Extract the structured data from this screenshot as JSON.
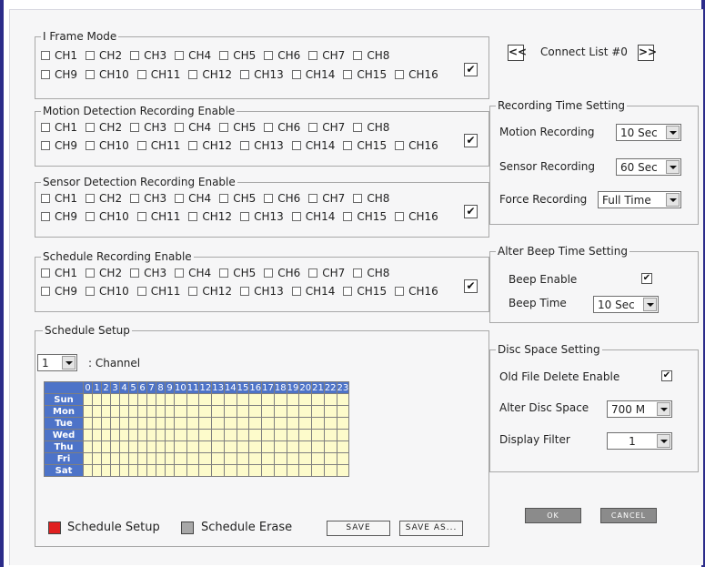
{
  "sections": {
    "iframe": {
      "legend": "I Frame Mode",
      "row1": [
        "CH1",
        "CH2",
        "CH3",
        "CH4",
        "CH5",
        "CH6",
        "CH7",
        "CH8"
      ],
      "row2": [
        "CH9",
        "CH10",
        "CH11",
        "CH12",
        "CH13",
        "CH14",
        "CH15",
        "CH16"
      ],
      "all_checked": true
    },
    "motion": {
      "legend": "Motion Detection Recording Enable",
      "row1": [
        "CH1",
        "CH2",
        "CH3",
        "CH4",
        "CH5",
        "CH6",
        "CH7",
        "CH8"
      ],
      "row2": [
        "CH9",
        "CH10",
        "CH11",
        "CH12",
        "CH13",
        "CH14",
        "CH15",
        "CH16"
      ],
      "all_checked": true
    },
    "sensor": {
      "legend": "Sensor Detection Recording Enable",
      "row1": [
        "CH1",
        "CH2",
        "CH3",
        "CH4",
        "CH5",
        "CH6",
        "CH7",
        "CH8"
      ],
      "row2": [
        "CH9",
        "CH10",
        "CH11",
        "CH12",
        "CH13",
        "CH14",
        "CH15",
        "CH16"
      ],
      "all_checked": true
    },
    "schedule": {
      "legend": "Schedule Recording Enable",
      "row1": [
        "CH1",
        "CH2",
        "CH3",
        "CH4",
        "CH5",
        "CH6",
        "CH7",
        "CH8"
      ],
      "row2": [
        "CH9",
        "CH10",
        "CH11",
        "CH12",
        "CH13",
        "CH14",
        "CH15",
        "CH16"
      ],
      "all_checked": true
    }
  },
  "connect": {
    "label": "Connect List #0",
    "prev": "<<",
    "next": ">>"
  },
  "recording_time": {
    "legend": "Recording Time Setting",
    "motion_label": "Motion Recording",
    "motion_value": "10 Sec",
    "sensor_label": "Sensor Recording",
    "sensor_value": "60 Sec",
    "force_label": "Force Recording",
    "force_value": "Full Time"
  },
  "beep": {
    "legend": "Alter Beep Time Setting",
    "enable_label": "Beep Enable",
    "enable_checked": true,
    "time_label": "Beep Time",
    "time_value": "10 Sec"
  },
  "disc": {
    "legend": "Disc Space Setting",
    "old_file_label": "Old File Delete Enable",
    "old_file_checked": true,
    "alter_label": "Alter Disc Space",
    "alter_value": "700 M",
    "filter_label": "Display Filter",
    "filter_value": "1"
  },
  "schedule_setup": {
    "legend": "Schedule Setup",
    "channel_value": "1",
    "channel_label": ": Channel",
    "hours": [
      "0",
      "1",
      "2",
      "3",
      "4",
      "5",
      "6",
      "7",
      "8",
      "9",
      "10",
      "11",
      "12",
      "13",
      "14",
      "15",
      "16",
      "17",
      "18",
      "19",
      "20",
      "21",
      "22",
      "23"
    ],
    "days": [
      "Sun",
      "Mon",
      "Tue",
      "Wed",
      "Thu",
      "Fri",
      "Sat"
    ],
    "setup_label": "Schedule Setup",
    "erase_label": "Schedule Erase",
    "save_label": "SAVE",
    "save_as_label": "SAVE AS...",
    "setup_color": "#e02020",
    "erase_color": "#a8a8a8"
  },
  "buttons": {
    "ok": "OK",
    "cancel": "CANCEL"
  },
  "accent": {
    "grid_header": "#4d73c8",
    "grid_cell": "#fdfbcb",
    "frame_border": "#2c2c8a"
  }
}
